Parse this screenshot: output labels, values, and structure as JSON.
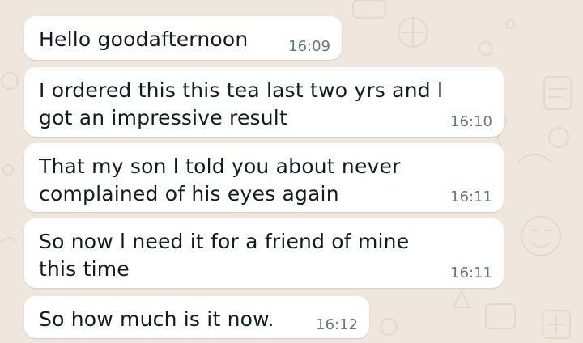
{
  "colors": {
    "chat_background": "#efe7dd",
    "incoming_bubble": "#ffffff",
    "message_text": "#111b21",
    "timestamp_text": "#667781"
  },
  "messages": [
    {
      "text": "Hello goodafternoon",
      "time": "16:09"
    },
    {
      "text": "I ordered this this tea last two yrs and l\ngot an impressive result",
      "time": "16:10"
    },
    {
      "text": "That my son l told you about never\ncomplained of his eyes again",
      "time": "16:11"
    },
    {
      "text": "So now l need it for a friend of mine\nthis time",
      "time": "16:11"
    },
    {
      "text": "So how much is it now.",
      "time": "16:12"
    }
  ]
}
